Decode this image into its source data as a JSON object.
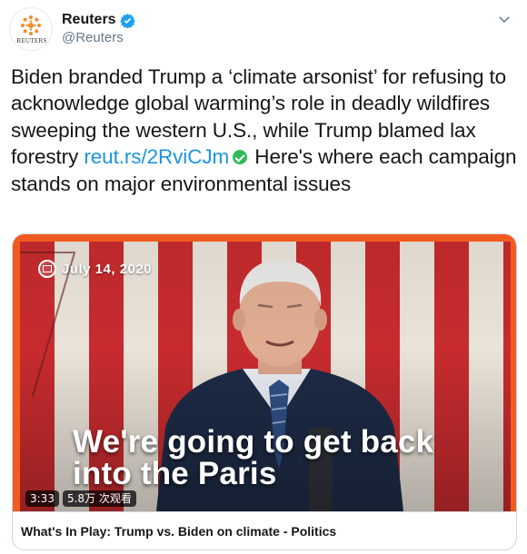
{
  "tweet": {
    "avatar_wordmark": "REUTERS",
    "display_name": "Reuters",
    "handle": "@Reuters",
    "text_before_link": "Biden branded Trump a ‘climate arsonist’ for refusing to acknowledge global warming’s role in deadly wildfires sweeping the western U.S., while Trump blamed lax forestry ",
    "link_text": "reut.rs/2RviCJm",
    "text_after_link": " Here's where each campaign stands on major environmental issues"
  },
  "media": {
    "date_label": "July 14, 2020",
    "caption_line1": "We're going to get back",
    "caption_line2": "into the Paris",
    "duration": "3:33",
    "views": "5.8万 次观看",
    "card_title": "What's In Play: Trump vs. Biden on climate - Politics"
  },
  "colors": {
    "accent_link": "#1b95e0",
    "verified": "#1da1f2",
    "card_border_brand": "#f25b1f",
    "check_emoji": "#2ebd59"
  },
  "icons": [
    "reuters-logo-icon",
    "verified-badge-icon",
    "chevron-down-icon",
    "check-mark-emoji-icon",
    "calendar-icon"
  ]
}
